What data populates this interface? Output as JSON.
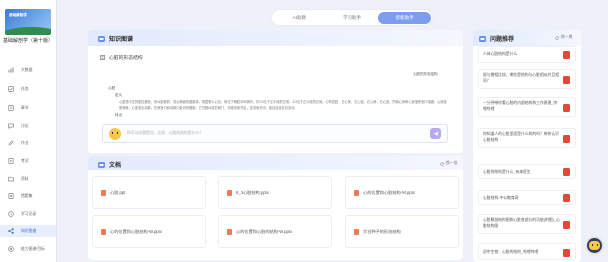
{
  "sidebar": {
    "cover_text": "基础解剖学",
    "course_title": "基础解剖学（第十版）",
    "items": [
      {
        "label": "大数据",
        "icon": "data-icon"
      },
      {
        "label": "任务",
        "icon": "task-icon"
      },
      {
        "label": "章节",
        "icon": "chapter-icon"
      },
      {
        "label": "讨论",
        "icon": "discussion-icon"
      },
      {
        "label": "作业",
        "icon": "homework-icon"
      },
      {
        "label": "考试",
        "icon": "exam-icon"
      },
      {
        "label": "资料",
        "icon": "material-icon"
      },
      {
        "label": "错题集",
        "icon": "wrongbook-icon"
      },
      {
        "label": "学习记录",
        "icon": "record-icon"
      },
      {
        "label": "知识图谱",
        "icon": "graph-icon"
      },
      {
        "label": "能力图谱/目标",
        "icon": "ability-icon"
      }
    ],
    "active_index": 9
  },
  "tabs": [
    {
      "label": "AI助教"
    },
    {
      "label": "学习助手"
    },
    {
      "label": "智能助手"
    }
  ],
  "active_tab": 2,
  "knowledge": {
    "title": "知识图谱",
    "map_title": "心脏的形态结构",
    "right_note": "心脏的形态结构",
    "root": "心脏",
    "definition": "定义",
    "body": "心脏是中空的肌性器官，形似倒置的、前后稍扁的圆锥体，周围裹以心包，斜位于胸腔中纵隔内，约2/3位于正中线的左侧，1/3位于正中线的右侧。心有四腔：左心房、左心室、右心房、右心室。同侧心房和心室借房室口相通，心房接受静脉，心室发出动脉。在房室口和动脉口处均有瓣膜，它们颇似泵的阀门，可顺流而开启，逆流而关闭，保证血液定向流动。",
    "more": "特点",
    "ask_placeholder": "你可以向我提问，比如：心脏的结构是什么？"
  },
  "docs": {
    "title": "文档",
    "refresh_label": "换一批",
    "items": [
      {
        "name": "心脏.ppt"
      },
      {
        "name": "9_3心脏结构.pptx"
      },
      {
        "name": "心的位置和心脏结构-W.pptx"
      },
      {
        "name": "心的位置和心脏结构-W.pptx"
      },
      {
        "name": "心的位置和心脏的结构-W.pptx"
      },
      {
        "name": "大谷种子的形态结构"
      }
    ]
  },
  "recommend": {
    "title": "问题推荐",
    "refresh_label": "换一换",
    "items": [
      {
        "text": "人体心脏结构是什么"
      },
      {
        "text": "鼠与猪相比较，哪些是结构与心脏相似并且相同？"
      },
      {
        "text": "一分钟带你看心脏的内部结构和工作原理_哔哩哔哩"
      },
      {
        "text": "你知道人的心脏里面是什么样的吗？带你认识心脏结构"
      },
      {
        "text": "心脏的结构是什么_有来医生"
      },
      {
        "text": "心脏结构-中公教育网"
      },
      {
        "text": "心脏解剖结构图和心脏各部分的功能(附图)_心脏结构图"
      },
      {
        "text": "初中生物：心脏的结构_哔哩哔哩"
      }
    ]
  },
  "colors": {
    "accent": "#7d9df1",
    "active_text": "#3a6bd9",
    "pdf": "#f07b52",
    "red_icon": "#e4473a"
  }
}
